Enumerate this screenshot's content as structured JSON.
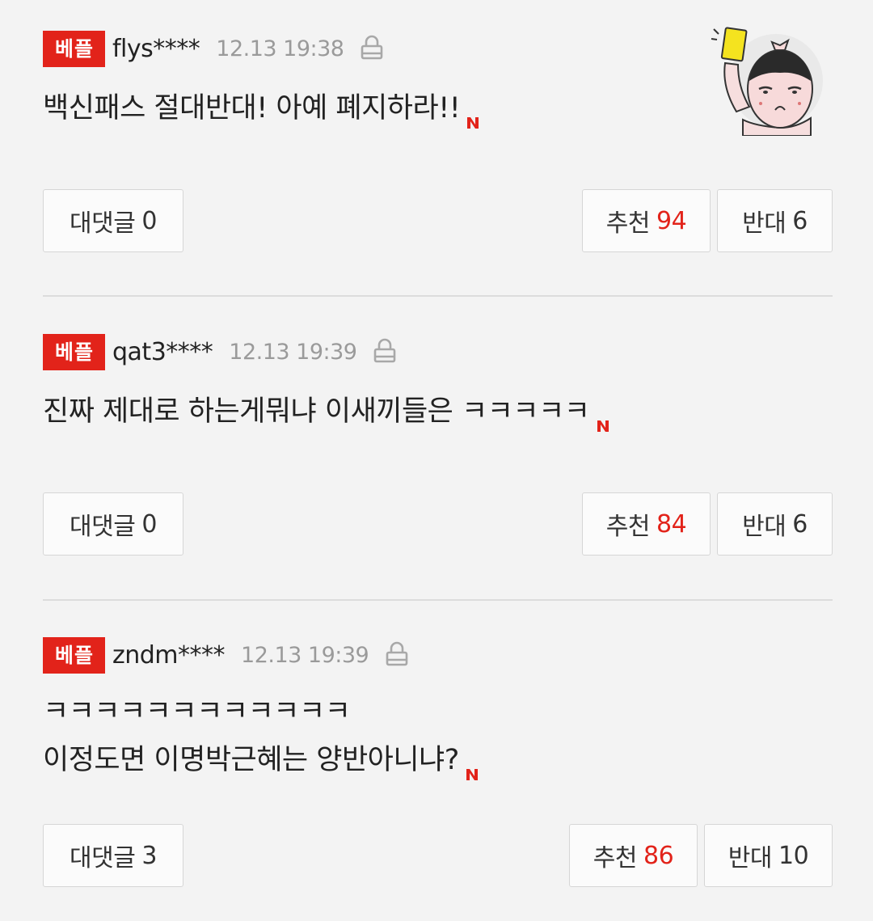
{
  "colors": {
    "accent_red": "#e2231a",
    "muted_gray": "#9a9a9a",
    "background": "#f3f3f3"
  },
  "comments": [
    {
      "badge": "베플",
      "username": "flys****",
      "timestamp": "12.13 19:38",
      "lines": [
        "백신패스 절대반대! 아예 폐지하라!!"
      ],
      "reply_label": "대댓글",
      "reply_count": "0",
      "upvote_label": "추천",
      "upvote_count": "94",
      "downvote_label": "반대",
      "downvote_count": "6"
    },
    {
      "badge": "베플",
      "username": "qat3****",
      "timestamp": "12.13 19:39",
      "lines": [
        "진짜 제대로 하는게뭐냐 이새끼들은 ㅋㅋㅋㅋㅋ"
      ],
      "reply_label": "대댓글",
      "reply_count": "0",
      "upvote_label": "추천",
      "upvote_count": "84",
      "downvote_label": "반대",
      "downvote_count": "6"
    },
    {
      "badge": "베플",
      "username": "zndm****",
      "timestamp": "12.13 19:39",
      "lines": [
        "ㅋㅋㅋㅋㅋㅋㅋㅋㅋㅋㅋㅋ",
        "이정도면 이명박근혜는 양반아니냐?"
      ],
      "reply_label": "대댓글",
      "reply_count": "3",
      "upvote_label": "추천",
      "upvote_count": "86",
      "downvote_label": "반대",
      "downvote_count": "10"
    }
  ],
  "icons": {
    "lock": "lock-icon",
    "new": "new-n-icon",
    "avatar": "yellow-card-referee-sticker"
  }
}
